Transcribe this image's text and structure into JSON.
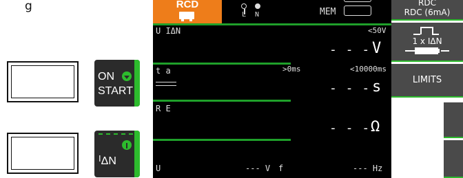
{
  "left": {
    "top_label": "g",
    "start_button": {
      "line1": "ON",
      "line2": "START"
    },
    "idn_button": {
      "label_prefix": "I",
      "label_sub": "ΔN"
    }
  },
  "status_bar": {
    "mode": "RCD",
    "probe_left": "L",
    "probe_right": "N",
    "mem_label": "MEM"
  },
  "fields": {
    "u_idn": {
      "label": "U IΔN",
      "limit": "<50V",
      "value": "- - -",
      "unit": "V"
    },
    "ta": {
      "label": "t a",
      "limit_low": ">0ms",
      "limit_high": "<10000ms",
      "value": "- - -",
      "unit": "s"
    },
    "re": {
      "label": "R E",
      "value": "- - -",
      "unit": "Ω"
    }
  },
  "footer": {
    "u_label": "U",
    "voltage": "--- V",
    "f_label": "f",
    "frequency": "--- Hz"
  },
  "softkeys": {
    "rdc": {
      "line1": "RDC",
      "line2": "RDC (6mA)"
    },
    "pulse": {
      "label": "1 x IΔN"
    },
    "limits": {
      "label": "LIMITS"
    }
  },
  "colors": {
    "accent": "#ee7d1a",
    "green": "#2dbb2d",
    "line_green": "#1fa02a",
    "display_bg": "#000000",
    "softkey_bg": "#4a4a4a"
  }
}
